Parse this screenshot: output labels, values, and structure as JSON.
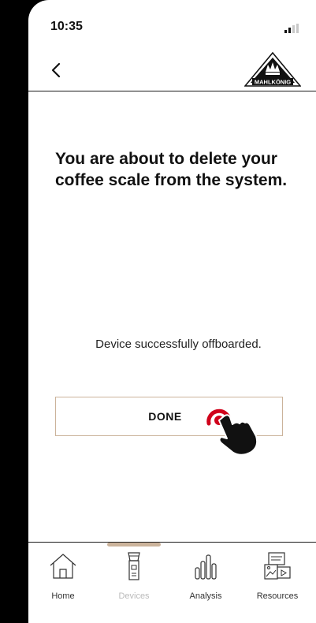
{
  "status_bar": {
    "time": "10:35"
  },
  "nav": {
    "logo_text": "MAHLKÖNIG"
  },
  "main": {
    "headline": "You are about to delete your coffee scale from the system.",
    "status_message": "Device successfully offboarded.",
    "done_label": "DONE"
  },
  "tabs": [
    {
      "label": "Home",
      "icon": "home-icon",
      "active": false
    },
    {
      "label": "Devices",
      "icon": "grinder-icon",
      "active": true
    },
    {
      "label": "Analysis",
      "icon": "bar-chart-icon",
      "active": false
    },
    {
      "label": "Resources",
      "icon": "resources-icon",
      "active": false
    }
  ],
  "colors": {
    "accent": "#cbb39b",
    "tap_ring": "#d0021b",
    "inactive_tab": "#bbbbbb"
  }
}
